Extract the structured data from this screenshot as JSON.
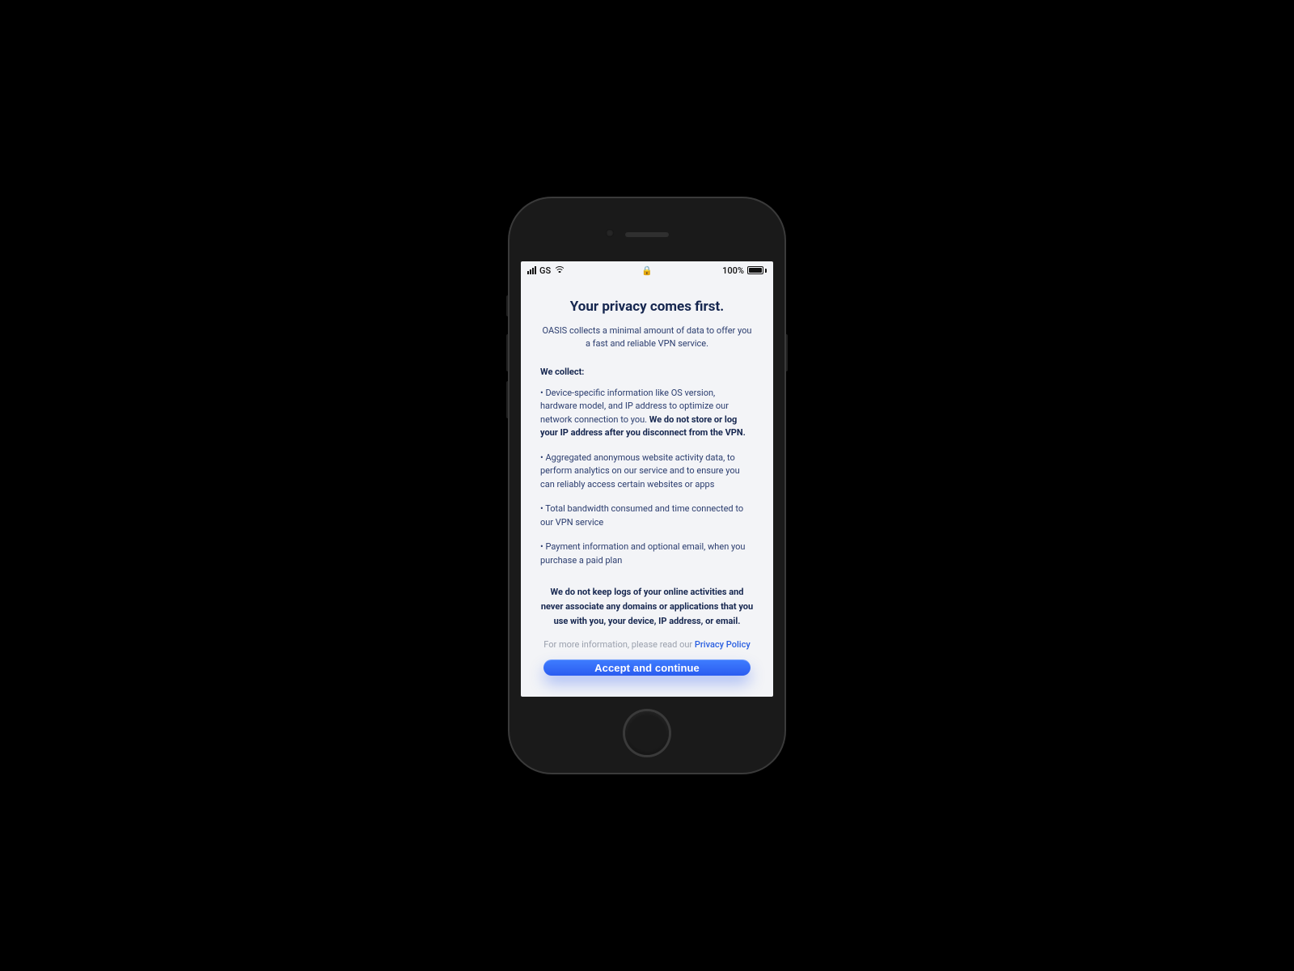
{
  "statusbar": {
    "carrier": "GS",
    "battery_pct": "100%"
  },
  "screen": {
    "title": "Your privacy comes first.",
    "subtitle": "OASIS collects a minimal amount of data to offer you a fast and reliable VPN service.",
    "collect_heading": "We collect:",
    "bullets": {
      "b1_pre": "Device-specific information like OS version, hardware model, and IP address to optimize our network connection to you. ",
      "b1_bold": "We do not store or log your IP address after you disconnect from the VPN.",
      "b2": "Aggregated anonymous website activity data, to perform analytics on our service and to ensure you can reliably access certain websites or apps",
      "b3": "Total bandwidth consumed and time connected to our VPN service",
      "b4": "Payment information and optional email, when you purchase a paid plan"
    },
    "no_logs": "We do not keep logs of your online activities and never associate any domains or applications that you use with  you, your device, IP address, or email.",
    "more_info_pre": "For more information, please read our ",
    "privacy_link": "Privacy Policy",
    "cta": "Accept and continue"
  }
}
